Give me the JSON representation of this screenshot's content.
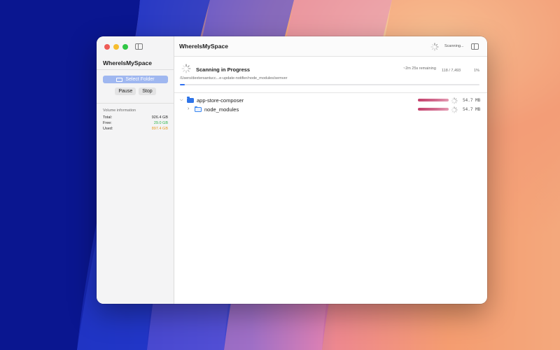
{
  "colors": {
    "accent": "#2f6ff0",
    "select_button": "#9fb7f0",
    "free": "#2fb54a",
    "used": "#e89a1e",
    "size_bar": "#c4406b"
  },
  "sidebar": {
    "app_name": "WhereIsMySpace",
    "select_folder_label": "Select Folder",
    "select_folder_icon": "folder-open-icon",
    "pause_label": "Pause",
    "stop_label": "Stop",
    "volume": {
      "title": "Volume information",
      "rows": [
        {
          "label": "Total:",
          "value": "926.4 GB"
        },
        {
          "label": "Free:",
          "value": "29.0 GB"
        },
        {
          "label": "Used:",
          "value": "897.4 GB"
        }
      ]
    }
  },
  "titlebar": {
    "title": "WhereIsMySpace",
    "status": "Scanning..."
  },
  "progress": {
    "title": "Scanning in Progress",
    "remaining": "~2m 25s remaining",
    "count": "118 / 7,493",
    "percent": "1%",
    "path": "/Users/dextersantucc...e-update-notifier/node_modules/semver",
    "fraction": 0.016
  },
  "tree": [
    {
      "name": "app-store-composer",
      "size": "54.7 MB",
      "expanded": true,
      "depth": 0
    },
    {
      "name": "node_modules",
      "size": "54.7 MB",
      "expanded": false,
      "depth": 1
    }
  ]
}
